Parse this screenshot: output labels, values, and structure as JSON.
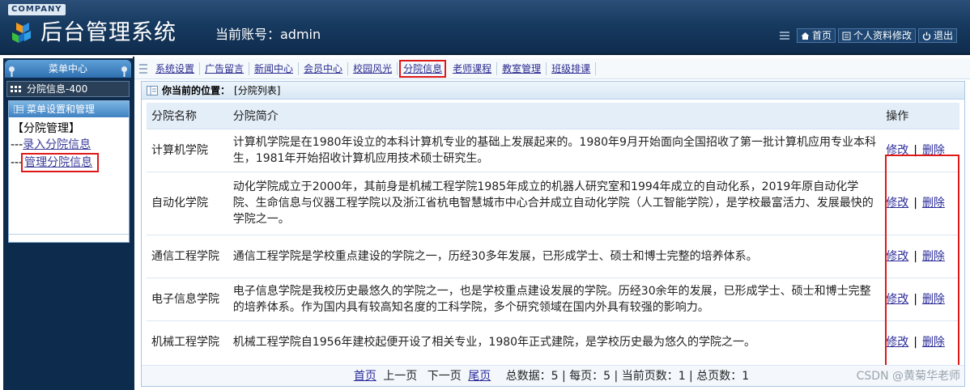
{
  "header": {
    "company": "COMPANY",
    "app_title": "后台管理系统",
    "account_label": "当前账号：admin",
    "buttons": {
      "home": "首页",
      "profile": "个人资料修改",
      "logout": "退出"
    }
  },
  "sidebar": {
    "menu_center": "菜单中心",
    "section": "分院信息-400",
    "box_title": "菜单设置和管理",
    "group": "【分院管理】",
    "links": [
      {
        "prefix": "---",
        "label": "录入分院信息"
      },
      {
        "prefix": "---",
        "label": "管理分院信息"
      }
    ]
  },
  "nav": {
    "items": [
      "系统设置",
      "广告留言",
      "新闻中心",
      "会员中心",
      "校园风光",
      "分院信息",
      "老师课程",
      "教室管理",
      "班级排课"
    ],
    "active": "分院信息"
  },
  "panel": {
    "location_label": "你当前的位置：",
    "location_value": "[分院列表]"
  },
  "table": {
    "headers": [
      "分院名称",
      "分院简介",
      "操作"
    ],
    "rows": [
      {
        "name": "计算机学院",
        "desc": "计算机学院是在1980年设立的本科计算机专业的基础上发展起来的。1980年9月开始面向全国招收了第一批计算机应用专业本科生，1981年开始招收计算机应用技术硕士研究生。"
      },
      {
        "name": "自动化学院",
        "desc": "动化学院成立于2000年，其前身是机械工程学院1985年成立的机器人研究室和1994年成立的自动化系，2019年原自动化学院、生命信息与仪器工程学院以及浙江省杭电智慧城市中心合并成立自动化学院（人工智能学院），是学校最富活力、发展最快的学院之一。"
      },
      {
        "name": "通信工程学院",
        "desc": "通信工程学院是学校重点建设的学院之一，历经30多年发展，已形成学士、硕士和博士完整的培养体系。"
      },
      {
        "name": "电子信息学院",
        "desc": "电子信息学院是我校历史最悠久的学院之一，也是学校重点建设发展的学院。历经30余年的发展，已形成学士、硕士和博士完整的培养体系。作为国内具有较高知名度的工科学院，多个研究领域在国内外具有较强的影响力。"
      },
      {
        "name": "机械工程学院",
        "desc": "机械工程学院自1956年建校起便开设了相关专业，1980年正式建院，是学校历史最为悠久的学院之一。"
      }
    ],
    "edit_label": "修改",
    "sep": "|",
    "delete_label": "删除"
  },
  "pager": {
    "first": "首页",
    "prev": "上一页",
    "next": "下一页",
    "last": "尾页",
    "stats": "总数据：5 | 每页：5 | 当前页数：1 | 总页数：1"
  },
  "watermark": "CSDN @黄菊华老师",
  "colors": {
    "header_bg": "#173a60",
    "highlight": "#e01818",
    "link": "#2b2b9a"
  }
}
